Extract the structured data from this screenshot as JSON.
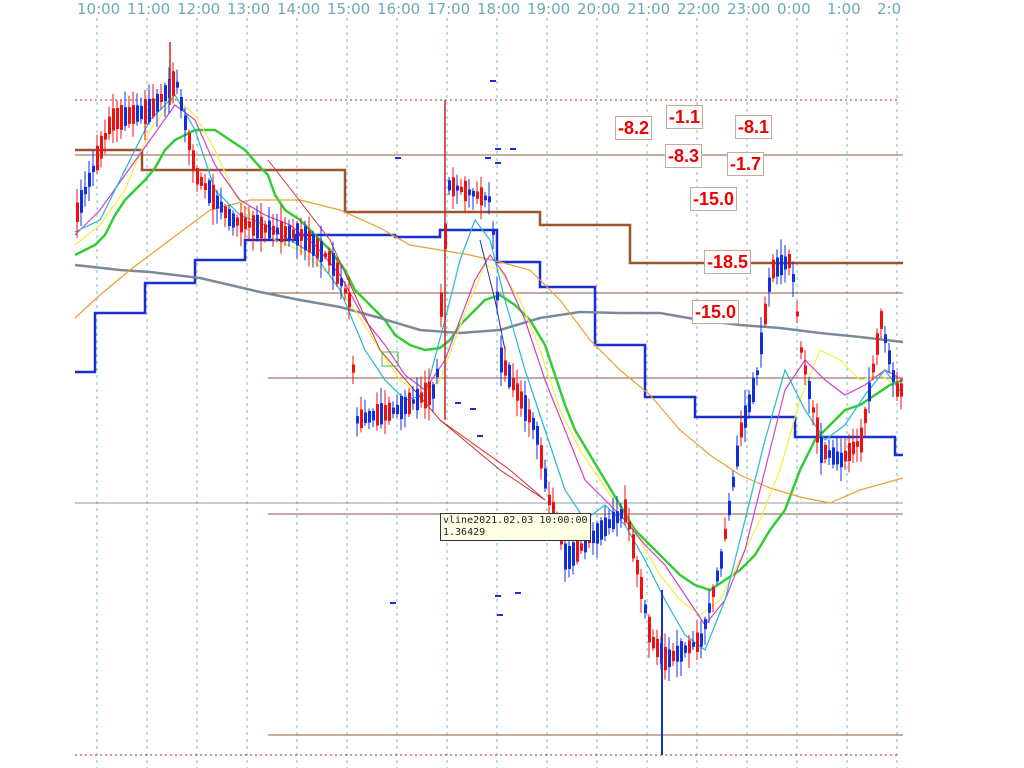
{
  "time_axis": {
    "labels": [
      "10:00",
      "11:00",
      "12:00",
      "13:00",
      "14:00",
      "15:00",
      "16:00",
      "17:00",
      "18:00",
      "19:00",
      "20:00",
      "21:00",
      "22:00",
      "23:00",
      "0:00",
      "1:00",
      "2:0"
    ]
  },
  "value_boxes": [
    "-8.2",
    "-1.1",
    "-8.1",
    "-8.3",
    "-1.7",
    "-15.0",
    "-18.5",
    "-15.0"
  ],
  "tooltip": {
    "line1": "vline2021.02.03 10:00:00",
    "line2": "1.36429"
  },
  "colors": {
    "bull_candle": "#1030e0",
    "bear_candle": "#ee1111",
    "level_line": "#8b5a3c",
    "step_blue": "#1a2fd0",
    "step_green": "#33cc33",
    "step_brown": "#9a5530",
    "ma_gray": "#7a8a98",
    "ma_orange": "#e8a030",
    "ma_yellow": "#f0f040",
    "ma_magenta": "#d040d0",
    "ma_cyan": "#20b8d8",
    "grid": "#7fb5c5",
    "value_text": "#ee0000"
  }
}
